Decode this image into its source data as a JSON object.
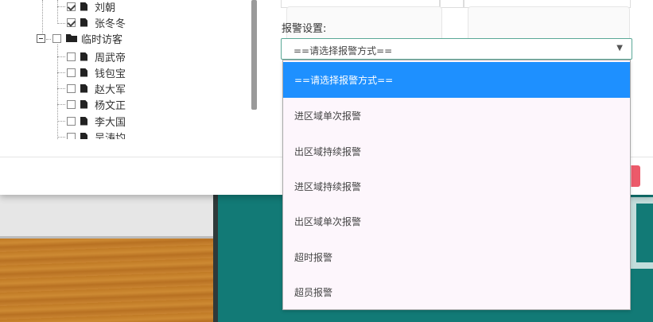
{
  "tree": {
    "items": [
      {
        "label": "刘朝",
        "checked": true
      },
      {
        "label": "张冬冬",
        "checked": true
      },
      {
        "label": "临时访客",
        "checked": false
      },
      {
        "label": "周武帝",
        "checked": false
      },
      {
        "label": "钱包宝",
        "checked": false
      },
      {
        "label": "赵大军",
        "checked": false
      },
      {
        "label": "杨文正",
        "checked": false
      },
      {
        "label": "李大国",
        "checked": false
      },
      {
        "label": "吴涛均",
        "checked": false
      }
    ]
  },
  "form": {
    "alarm_label": "报警设置:",
    "alarm_select": {
      "selected": "==请选择报警方式==",
      "options": [
        "==请选择报警方式==",
        "进区域单次报警",
        "出区域持续报警",
        "进区域持续报警",
        "出区域单次报警",
        "超时报警",
        "超员报警"
      ]
    }
  },
  "colors": {
    "selected_option": "#1e90ff",
    "select_border": "#5aa896",
    "danger_button": "#ec5a6a"
  }
}
